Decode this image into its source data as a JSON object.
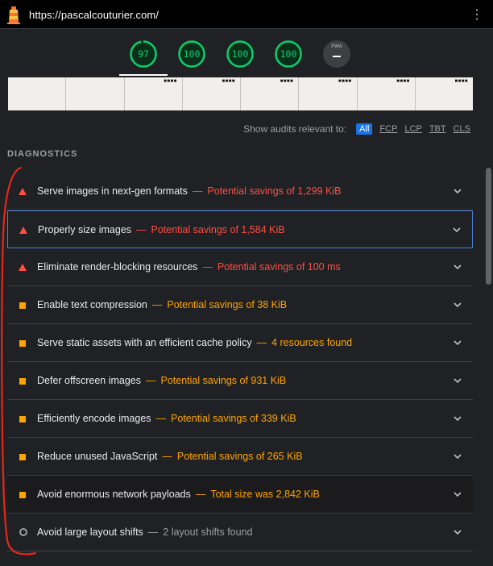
{
  "browser": {
    "url": "https://pascalcouturier.com/",
    "menu_icon": "kebab-menu-icon"
  },
  "scores": [
    {
      "name": "performance",
      "value": "97",
      "color": "#0cce6b"
    },
    {
      "name": "accessibility",
      "value": "100",
      "color": "#0cce6b"
    },
    {
      "name": "best-practices",
      "value": "100",
      "color": "#0cce6b"
    },
    {
      "name": "seo",
      "value": "100",
      "color": "#0cce6b"
    },
    {
      "name": "pwa",
      "value": "PWA"
    }
  ],
  "filter": {
    "label": "Show audits relevant to:",
    "options": [
      "All",
      "FCP",
      "LCP",
      "TBT",
      "CLS"
    ],
    "active": "All"
  },
  "section": {
    "title": "DIAGNOSTICS"
  },
  "audits": [
    {
      "severity": "fail",
      "title": "Serve images in next-gen formats",
      "detail": "Potential savings of 1,299 KiB"
    },
    {
      "severity": "fail",
      "title": "Properly size images",
      "detail": "Potential savings of 1,584 KiB"
    },
    {
      "severity": "fail",
      "title": "Eliminate render-blocking resources",
      "detail": "Potential savings of 100 ms"
    },
    {
      "severity": "avg",
      "title": "Enable text compression",
      "detail": "Potential savings of 38 KiB"
    },
    {
      "severity": "avg",
      "title": "Serve static assets with an efficient cache policy",
      "detail": "4 resources found"
    },
    {
      "severity": "avg",
      "title": "Defer offscreen images",
      "detail": "Potential savings of 931 KiB"
    },
    {
      "severity": "avg",
      "title": "Efficiently encode images",
      "detail": "Potential savings of 339 KiB"
    },
    {
      "severity": "avg",
      "title": "Reduce unused JavaScript",
      "detail": "Potential savings of 265 KiB"
    },
    {
      "severity": "avg",
      "title": "Avoid enormous network payloads",
      "detail": "Total size was 2,842 KiB"
    },
    {
      "severity": "info",
      "title": "Avoid large layout shifts",
      "detail": "2 layout shifts found"
    }
  ],
  "colors": {
    "fail": "#ff4e42",
    "average": "#ffa400",
    "pass": "#0cce6b",
    "accent": "#1a73e8"
  }
}
